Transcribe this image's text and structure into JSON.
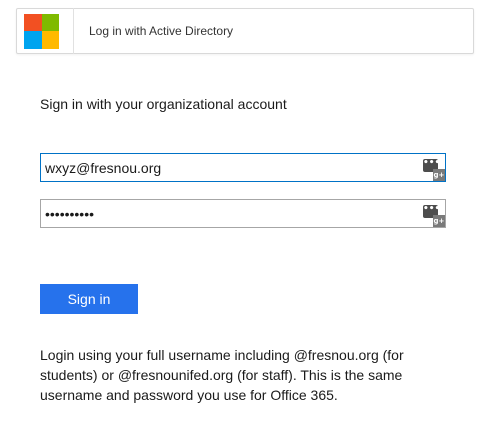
{
  "ad_button": {
    "label": "Log in with Active Directory",
    "logo_colors": [
      "#f25022",
      "#7fba00",
      "#00a4ef",
      "#ffb900"
    ]
  },
  "form": {
    "heading": "Sign in with your organizational account",
    "username": {
      "value": "wxyz@fresnou.org",
      "placeholder": ""
    },
    "password": {
      "value": "••••••••••",
      "placeholder": ""
    },
    "password_manager_icon": {
      "key_glyph": "•••",
      "badge_glyph": "g+"
    },
    "submit_label": "Sign in"
  },
  "help_text": "Login using your full username including @fresnou.org (for students) or @fresnounifed.org (for staff). This is the same username and password you use for Office 365.",
  "colors": {
    "accent": "#2672ec",
    "focus_border": "#0072c6"
  }
}
